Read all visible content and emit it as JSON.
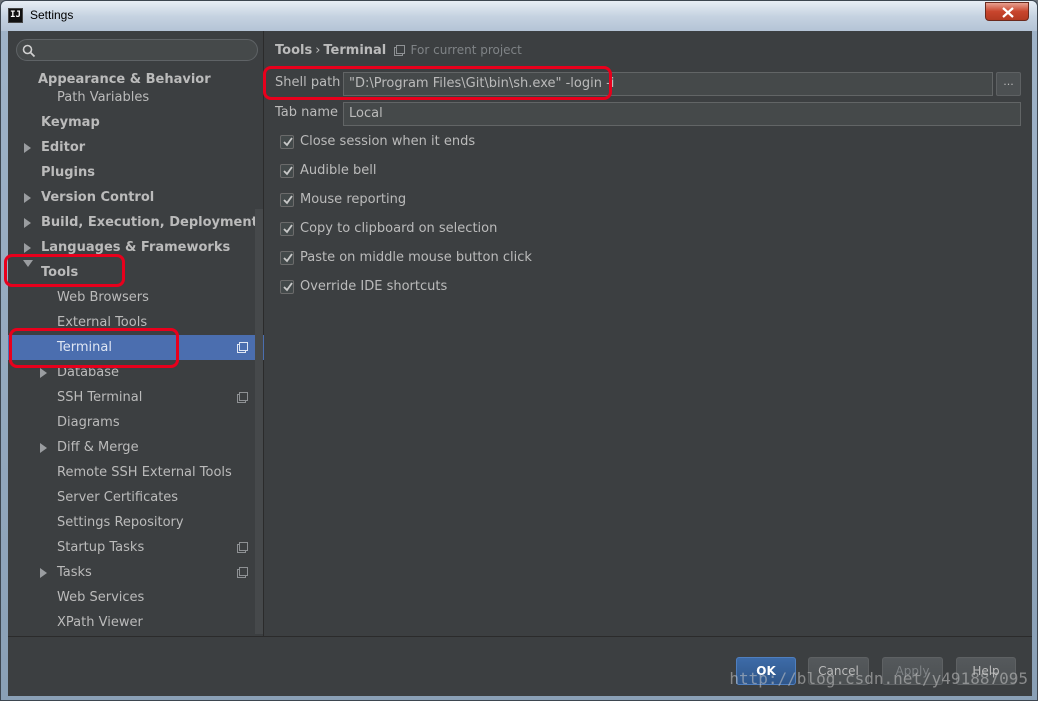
{
  "window": {
    "title": "Settings",
    "app_icon_text": "IJ"
  },
  "sidebar": {
    "search": {
      "placeholder": ""
    },
    "items": [
      {
        "label": "Appearance & Behavior",
        "bold": true
      },
      {
        "label": "Path Variables"
      },
      {
        "label": "Keymap",
        "bold": true
      },
      {
        "label": "Editor",
        "bold": true
      },
      {
        "label": "Plugins",
        "bold": true
      },
      {
        "label": "Version Control",
        "bold": true
      },
      {
        "label": "Build, Execution, Deployment",
        "bold": true
      },
      {
        "label": "Languages & Frameworks",
        "bold": true
      },
      {
        "label": "Tools",
        "bold": true
      },
      {
        "label": "Web Browsers"
      },
      {
        "label": "External Tools"
      },
      {
        "label": "Terminal",
        "selected": true
      },
      {
        "label": "Database"
      },
      {
        "label": "SSH Terminal"
      },
      {
        "label": "Diagrams"
      },
      {
        "label": "Diff & Merge"
      },
      {
        "label": "Remote SSH External Tools"
      },
      {
        "label": "Server Certificates"
      },
      {
        "label": "Settings Repository"
      },
      {
        "label": "Startup Tasks"
      },
      {
        "label": "Tasks"
      },
      {
        "label": "Web Services"
      },
      {
        "label": "XPath Viewer"
      }
    ]
  },
  "breadcrumb": {
    "parent": "Tools",
    "separator": "›",
    "current": "Terminal",
    "hint": "For current project"
  },
  "form": {
    "shell_path": {
      "label": "Shell path",
      "value": "\"D:\\Program Files\\Git\\bin\\sh.exe\" -login -i",
      "browse_label": "..."
    },
    "tab_name": {
      "label": "Tab name",
      "value": "Local"
    },
    "checkboxes": [
      {
        "label": "Close session when it ends",
        "checked": true
      },
      {
        "label": "Audible bell",
        "checked": true
      },
      {
        "label": "Mouse reporting",
        "checked": true
      },
      {
        "label": "Copy to clipboard on selection",
        "checked": true
      },
      {
        "label": "Paste on middle mouse button click",
        "checked": true
      },
      {
        "label": "Override IDE shortcuts",
        "checked": true
      }
    ]
  },
  "buttons": {
    "ok": "OK",
    "cancel": "Cancel",
    "apply": "Apply",
    "help": "Help"
  },
  "watermark": "http://blog.csdn.net/y491887095",
  "colors": {
    "selection": "#4b6eaf",
    "panel_bg": "#3c3f41",
    "annotation_red": "#e8001c",
    "ok_button": "#2f5689"
  }
}
